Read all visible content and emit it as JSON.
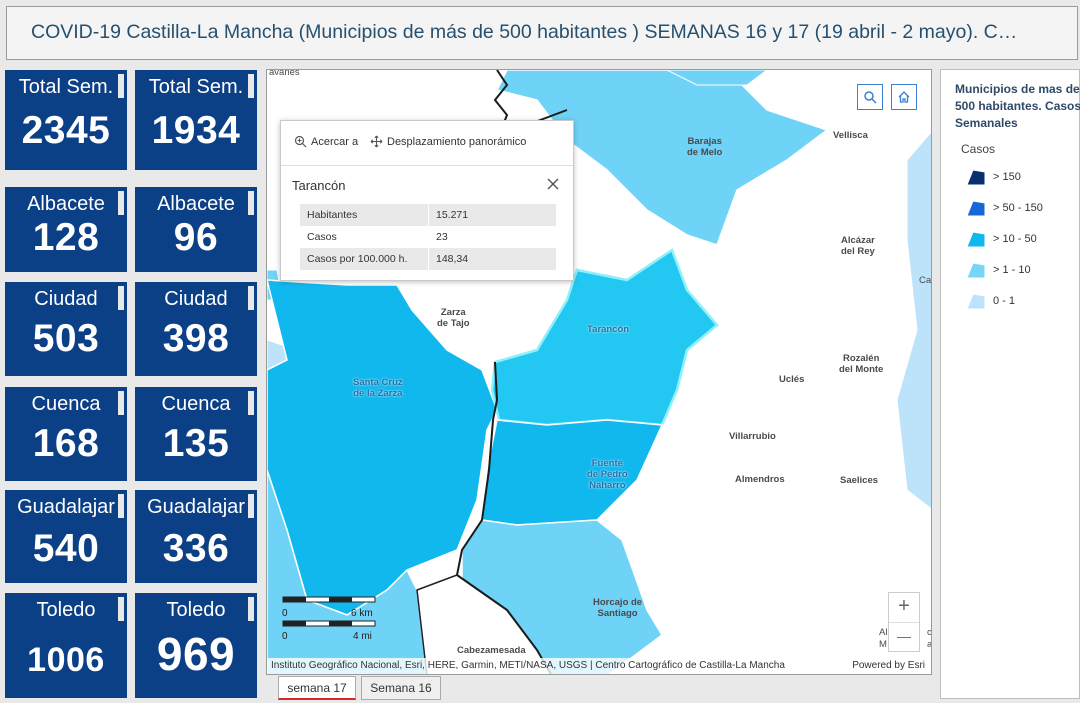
{
  "header": {
    "title": "COVID-19 Castilla-La Mancha (Municipios de más de 500 habitantes ) SEMANAS 16 y 17 (19 abril - 2 mayo). C…"
  },
  "tiles": {
    "total_17": {
      "label": "Total Sem.",
      "value": "2345"
    },
    "total_16": {
      "label": "Total Sem.",
      "value": "1934"
    },
    "albacete_17": {
      "label": "Albacete",
      "value": "128"
    },
    "albacete_16": {
      "label": "Albacete",
      "value": "96"
    },
    "ciudad_17": {
      "label": "Ciudad",
      "value": "503"
    },
    "ciudad_16": {
      "label": "Ciudad",
      "value": "398"
    },
    "cuenca_17": {
      "label": "Cuenca",
      "value": "168"
    },
    "cuenca_16": {
      "label": "Cuenca",
      "value": "135"
    },
    "guadalajara_17": {
      "label": "Guadalajar",
      "value": "540"
    },
    "guadalajara_16": {
      "label": "Guadalajar",
      "value": "336"
    },
    "toledo_17": {
      "label": "Toledo",
      "value": "1006"
    },
    "toledo_16": {
      "label": "Toledo",
      "value": "969"
    }
  },
  "map": {
    "places": {
      "barajas": "Barajas\nde Melo",
      "vellisca": "Vellisca",
      "alcazar": "Alcázar\ndel Rey",
      "zarza": "Zarza\nde Tajo",
      "tarancon": "Tarancón",
      "santa_cruz": "Santa Cruz\nde la Zarza",
      "rozalen": "Rozalén\ndel Monte",
      "ucles": "Uclés",
      "villarrubio": "Villarrubio",
      "fuente": "Fuente\nde Pedro\nNaharro",
      "almendros": "Almendros",
      "saelices": "Saelices",
      "horcajo": "Horcajo de\nSantiago",
      "cabezamesada": "Cabezamesada",
      "top_left_fragment": "avanes",
      "right_fragment": "Ca",
      "bottom_right_fragment_1": "Al",
      "bottom_right_fragment_2": "M",
      "bottom_right_fragment_3": "c",
      "bottom_right_fragment_4": "a"
    },
    "scale": {
      "zero_km": "0",
      "km": "6 km",
      "zero_mi": "0",
      "mi": "4 mi"
    },
    "attribution": "Instituto Geográfico Nacional, Esri, HERE, Garmin, METI/NASA, USGS | Centro Cartográfico de Castilla-La Mancha",
    "powered_by": "Powered by Esri",
    "zoom_in": "+",
    "zoom_out": "—"
  },
  "popup": {
    "zoom_to_label": "Acercar a",
    "pan_label": "Desplazamiento panorámico",
    "title": "Tarancón",
    "rows": [
      {
        "key": "Habitantes",
        "value": "15.271"
      },
      {
        "key": "Casos",
        "value": "23"
      },
      {
        "key": "Casos por 100.000 h.",
        "value": "148,34"
      }
    ]
  },
  "legend": {
    "title": "Municipios de mas de 500 habitantes. Casos Semanales",
    "subtitle": "Casos",
    "items": [
      {
        "label": "> 150",
        "color": "#0a2f6e"
      },
      {
        "label": "> 50 - 150",
        "color": "#1766d6"
      },
      {
        "label": "> 10 - 50",
        "color": "#11b8ee"
      },
      {
        "label": "> 1 - 10",
        "color": "#77d6f8"
      },
      {
        "label": "0 - 1",
        "color": "#bde3fb"
      }
    ]
  },
  "tabs": [
    {
      "label": "semana 17"
    },
    {
      "label": "Semana 16"
    }
  ],
  "colors": {
    "tile_bg": "#0b3f86",
    "accent_tab": "#d62828",
    "header_text": "#27506e"
  }
}
